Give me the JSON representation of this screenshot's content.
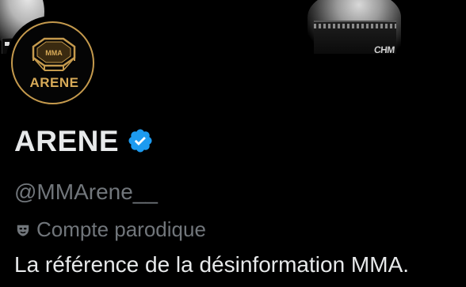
{
  "profile": {
    "display_name": "ARENE",
    "handle": "@MMArene__",
    "parody_label": "Compte parodique",
    "bio": "La référence de la désinformation MMA."
  },
  "avatar": {
    "logo_top_text": "MMA",
    "logo_text": "ARENE"
  },
  "banner": {
    "shorts_text": "CHM"
  },
  "icons": {
    "verified": "verified-badge-icon",
    "parody": "mask-icon"
  },
  "colors": {
    "background": "#000000",
    "primary_text": "#e7e9ea",
    "secondary_text": "#71767b",
    "verified_blue": "#1d9bf0",
    "logo_gold": "#c59a4d"
  }
}
